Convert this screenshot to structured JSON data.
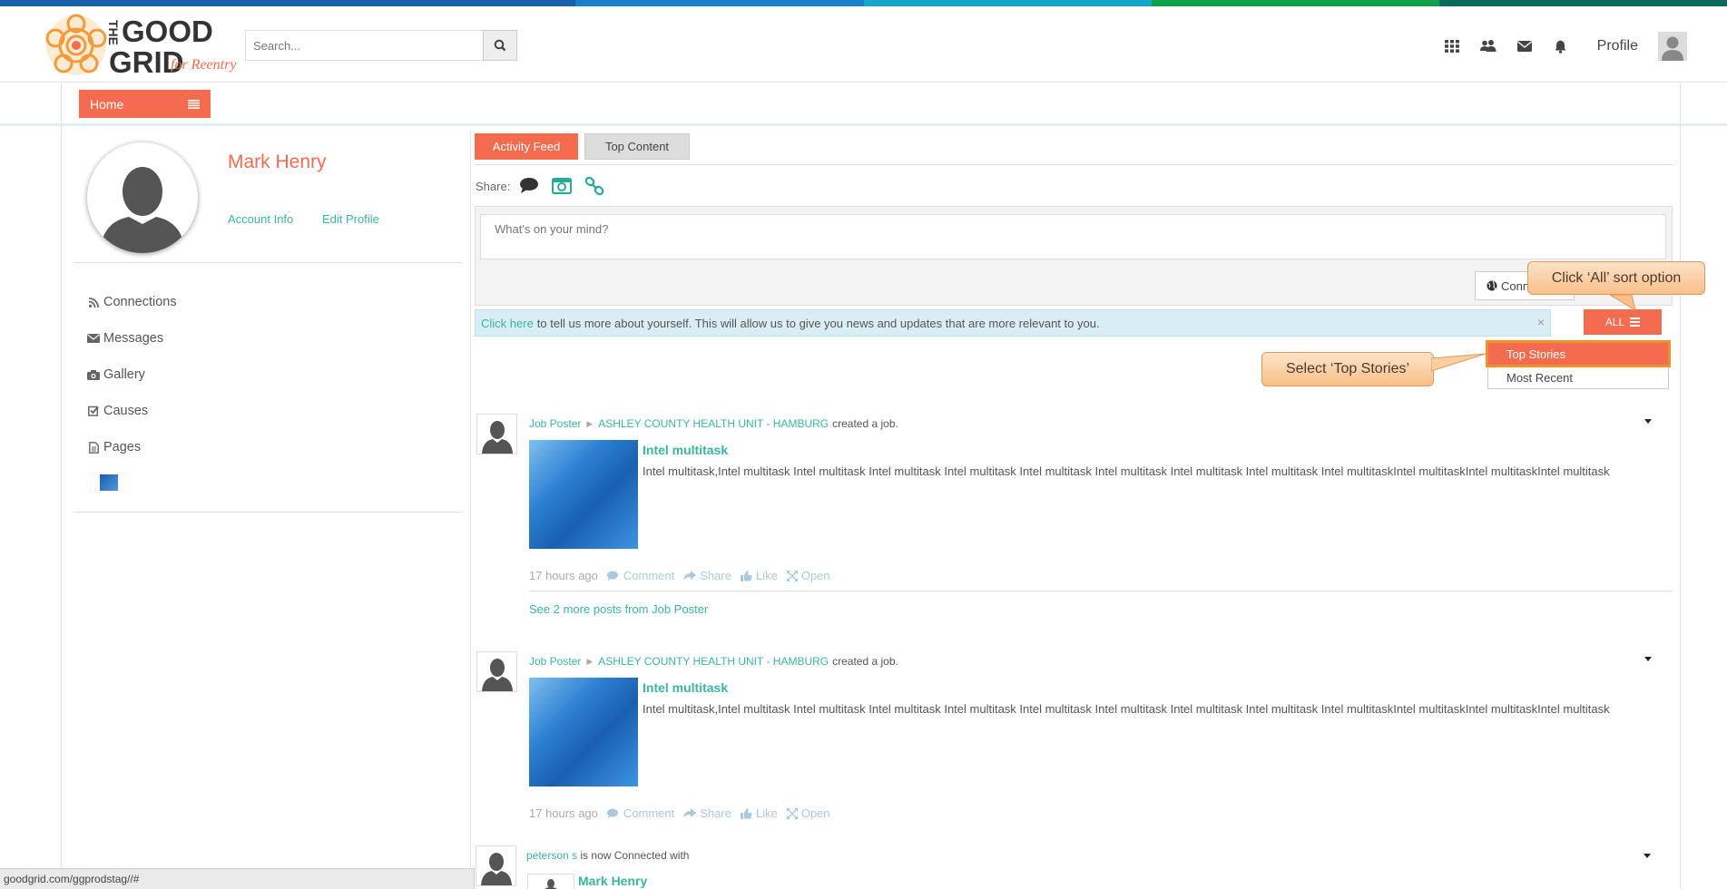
{
  "top_colors": [
    "#1560a8",
    "#1560a8",
    "#1b80c8",
    "#17a6c9",
    "#0fa14a",
    "#0b6a5c"
  ],
  "brand": {
    "logo_text_line1": "THE",
    "logo_text_line2": "GOOD",
    "logo_text_line3": "GRID",
    "logo_tagline": "for Reentry",
    "accent_color": "#f56b50",
    "link_color": "#3bb4a3"
  },
  "header": {
    "search_placeholder": "Search...",
    "search_icon": "search-icon",
    "icons": [
      "grid-icon",
      "users-icon",
      "envelope-icon",
      "bell-icon"
    ],
    "profile_label": "Profile"
  },
  "subnav": {
    "home_label": "Home"
  },
  "sidebar": {
    "user_name": "Mark Henry",
    "account_info": "Account Info",
    "edit_profile": "Edit Profile",
    "items": [
      {
        "label": "Connections",
        "icon": "rss-icon"
      },
      {
        "label": "Messages",
        "icon": "envelope-icon"
      },
      {
        "label": "Gallery",
        "icon": "camera-icon"
      },
      {
        "label": "Causes",
        "icon": "check-square-icon"
      },
      {
        "label": "Pages",
        "icon": "file-icon"
      }
    ]
  },
  "main": {
    "tabs": [
      {
        "label": "Activity Feed",
        "active": true
      },
      {
        "label": "Top Content",
        "active": false
      }
    ],
    "share_label": "Share:",
    "composer_placeholder": "What's on your mind?",
    "connections_button": "Conn",
    "info_link": "Click here",
    "info_text": "to tell us more about yourself. This will allow us to give you news and updates that are more relevant to you.",
    "info_close": "×",
    "sort_button": "ALL",
    "sort_options": [
      "Top Stories",
      "Most Recent"
    ],
    "callout_all": "Click ‘All’ sort option",
    "callout_top": "Select ‘Top Stories’"
  },
  "posts": [
    {
      "author": "Job Poster",
      "target": "ASHLEY COUNTY HEALTH UNIT - HAMBURG",
      "action": "created a job.",
      "title": "Intel multitask",
      "description": "Intel multitask,Intel multitask Intel multitask Intel multitask Intel multitask Intel multitask Intel multitask Intel multitask Intel multitask  Intel multitaskIntel multitaskIntel multitaskIntel multitask",
      "time": "17 hours ago",
      "actions": [
        "Comment",
        "Share",
        "Like",
        "Open"
      ],
      "see_more": "See 2 more posts from Job Poster"
    },
    {
      "author": "Job Poster",
      "target": "ASHLEY COUNTY HEALTH UNIT - HAMBURG",
      "action": "created a job.",
      "title": "Intel multitask",
      "description": "Intel multitask,Intel multitask Intel multitask Intel multitask Intel multitask Intel multitask Intel multitask Intel multitask Intel multitask  Intel multitaskIntel multitaskIntel multitaskIntel multitask",
      "time": "17 hours ago",
      "actions": [
        "Comment",
        "Share",
        "Like",
        "Open"
      ]
    },
    {
      "author": "peterson s",
      "action": "is now Connected with",
      "connected_name": "Mark Henry"
    }
  ],
  "status_url": "goodgrid.com/ggprodstag//#"
}
